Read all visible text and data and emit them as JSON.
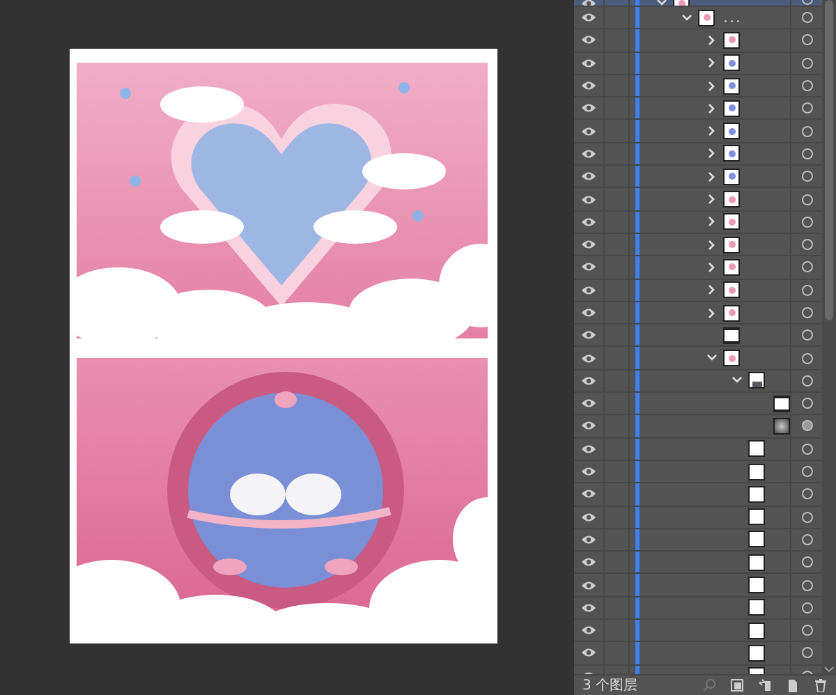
{
  "layers_panel": {
    "layers": [
      {
        "selected": true,
        "visible": true,
        "expanded": true,
        "kind": "pink",
        "children": [
          {
            "name": "...",
            "selected": false,
            "visible": true,
            "expanded": true,
            "kind": "pink",
            "children": [
              {
                "selected": false,
                "visible": true,
                "expanded": false,
                "expandable": true,
                "kind": "pink"
              },
              {
                "selected": false,
                "visible": true,
                "expanded": false,
                "expandable": true,
                "kind": "blue"
              },
              {
                "selected": false,
                "visible": true,
                "expanded": false,
                "expandable": true,
                "kind": "blue"
              },
              {
                "selected": false,
                "visible": true,
                "expanded": false,
                "expandable": true,
                "kind": "blue"
              },
              {
                "selected": false,
                "visible": true,
                "expanded": false,
                "expandable": true,
                "kind": "blue"
              },
              {
                "selected": false,
                "visible": true,
                "expanded": false,
                "expandable": true,
                "kind": "blue"
              },
              {
                "selected": false,
                "visible": true,
                "expanded": false,
                "expandable": true,
                "kind": "blue"
              },
              {
                "selected": false,
                "visible": true,
                "expanded": false,
                "expandable": true,
                "kind": "pink"
              },
              {
                "selected": false,
                "visible": true,
                "expanded": false,
                "expandable": true,
                "kind": "pink"
              },
              {
                "selected": false,
                "visible": true,
                "expanded": false,
                "expandable": true,
                "kind": "pink"
              },
              {
                "selected": false,
                "visible": true,
                "expanded": false,
                "expandable": true,
                "kind": "pink"
              },
              {
                "selected": false,
                "visible": true,
                "expanded": false,
                "expandable": true,
                "kind": "pink"
              },
              {
                "selected": false,
                "visible": true,
                "expanded": false,
                "expandable": true,
                "kind": "pink"
              },
              {
                "selected": false,
                "visible": true,
                "kind": "frame"
              },
              {
                "selected": false,
                "visible": true,
                "expanded": true,
                "kind": "pink",
                "children": [
                  {
                    "selected": false,
                    "visible": true,
                    "expanded": true,
                    "kind": "dark",
                    "children": [
                      {
                        "selected": false,
                        "visible": true,
                        "targeted": false,
                        "kind": "frame"
                      },
                      {
                        "selected": false,
                        "visible": true,
                        "targeted": true,
                        "kind": "gradient"
                      }
                    ]
                  },
                  {
                    "selected": false,
                    "visible": true,
                    "kind": "blank"
                  },
                  {
                    "selected": false,
                    "visible": true,
                    "kind": "blank"
                  },
                  {
                    "selected": false,
                    "visible": true,
                    "kind": "blank"
                  },
                  {
                    "selected": false,
                    "visible": true,
                    "kind": "blank"
                  },
                  {
                    "selected": false,
                    "visible": true,
                    "kind": "blank"
                  },
                  {
                    "selected": false,
                    "visible": true,
                    "kind": "blank"
                  },
                  {
                    "selected": false,
                    "visible": true,
                    "kind": "blank"
                  },
                  {
                    "selected": false,
                    "visible": true,
                    "kind": "blank"
                  },
                  {
                    "selected": false,
                    "visible": true,
                    "kind": "blank"
                  },
                  {
                    "selected": false,
                    "visible": true,
                    "kind": "blank"
                  },
                  {
                    "selected": false,
                    "visible": true,
                    "kind": "blank"
                  }
                ]
              }
            ]
          }
        ]
      }
    ],
    "status": "3 个图层"
  }
}
